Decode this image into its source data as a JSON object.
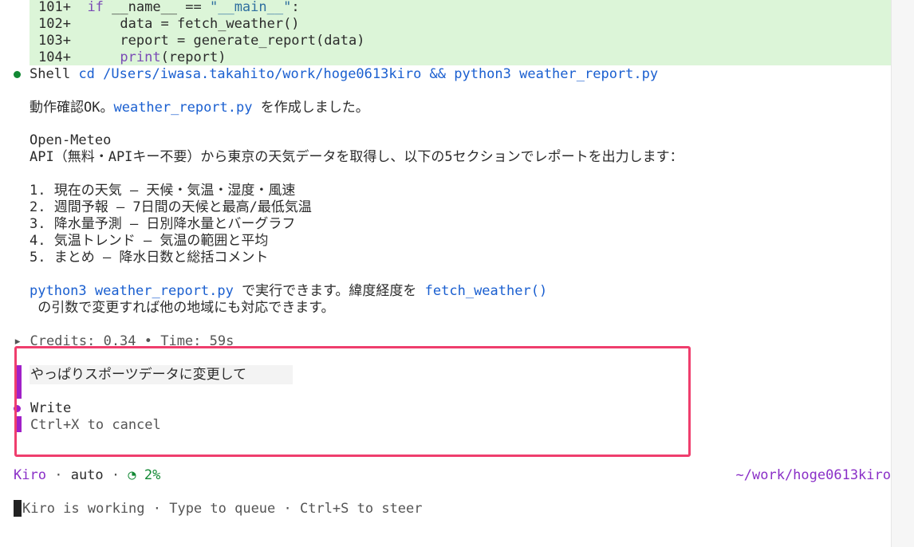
{
  "diff": {
    "lines": [
      {
        "num": "101+",
        "text_kw": "if ",
        "text_a": "__name__ == ",
        "text_str": "\"__main__\"",
        "text_b": ":"
      },
      {
        "num": "102+",
        "text": "    data = fetch_weather()"
      },
      {
        "num": "103+",
        "text": "    report = generate_report(data)"
      },
      {
        "num": "104+",
        "text_fn": "    print",
        "text": "(report)"
      }
    ]
  },
  "shell": {
    "label": "Shell",
    "command": "cd /Users/iwasa.takahito/work/hoge0613kiro && python3 weather_report.py"
  },
  "response": {
    "line1_pre": "動作確認OK。",
    "line1_file": "weather_report.py",
    "line1_post": " を作成しました。",
    "api_title": "Open-Meteo",
    "api_desc": "API（無料・APIキー不要）から東京の天気データを取得し、以下の5セクションでレポートを出力します：",
    "sections": [
      "1. 現在の天気 — 天候・気温・湿度・風速",
      "2. 週間予報 — 7日間の天候と最高/最低気温",
      "3. 降水量予測 — 日別降水量とバーグラフ",
      "4. 気温トレンド — 気温の範囲と平均",
      "5. まとめ — 降水日数と総括コメント"
    ],
    "run_cmd": "python3 weather_report.py",
    "run_mid": " で実行できます。緯度経度を ",
    "run_fn": "fetch_weather()",
    "run_line2": " の引数で変更すれば他の地域にも対応できます。"
  },
  "credits": "▸ Credits: 0.34 • Time: 59s",
  "prompt_box": {
    "user_input": "やっぱりスポーツデータに変更して",
    "status": "Write",
    "cancel_hint": "Ctrl+X to cancel"
  },
  "status_bar": {
    "app": "Kiro",
    "mode": "auto",
    "usage": "◔ 2%",
    "path": "~/work/hoge0613kiro"
  },
  "footer": {
    "hint": "Kiro is working · Type to queue · Ctrl+S to steer"
  },
  "colors": {
    "accent_purple": "#8a2fc7",
    "highlight_border": "#ef3e6d",
    "diff_bg": "#dcf5d8",
    "link_blue": "#1a5fd0"
  }
}
